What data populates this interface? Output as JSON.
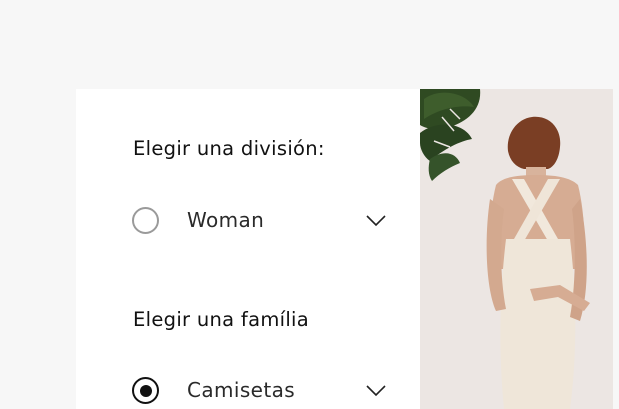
{
  "filters": {
    "division": {
      "title": "Elegir una división:",
      "selected_value": "Woman",
      "radio_selected": false
    },
    "family": {
      "title": "Elegir una família",
      "selected_value": "Camisetas",
      "radio_selected": true
    }
  },
  "icons": {
    "radio_empty": "radio-unselected-icon",
    "radio_filled": "radio-selected-icon",
    "chevron": "chevron-down-icon"
  },
  "colors": {
    "page_background": "#f7f7f7",
    "card_background": "#ffffff",
    "text": "#111111",
    "radio_border": "#9a9a9a",
    "photo_background": "#ece6e3"
  }
}
